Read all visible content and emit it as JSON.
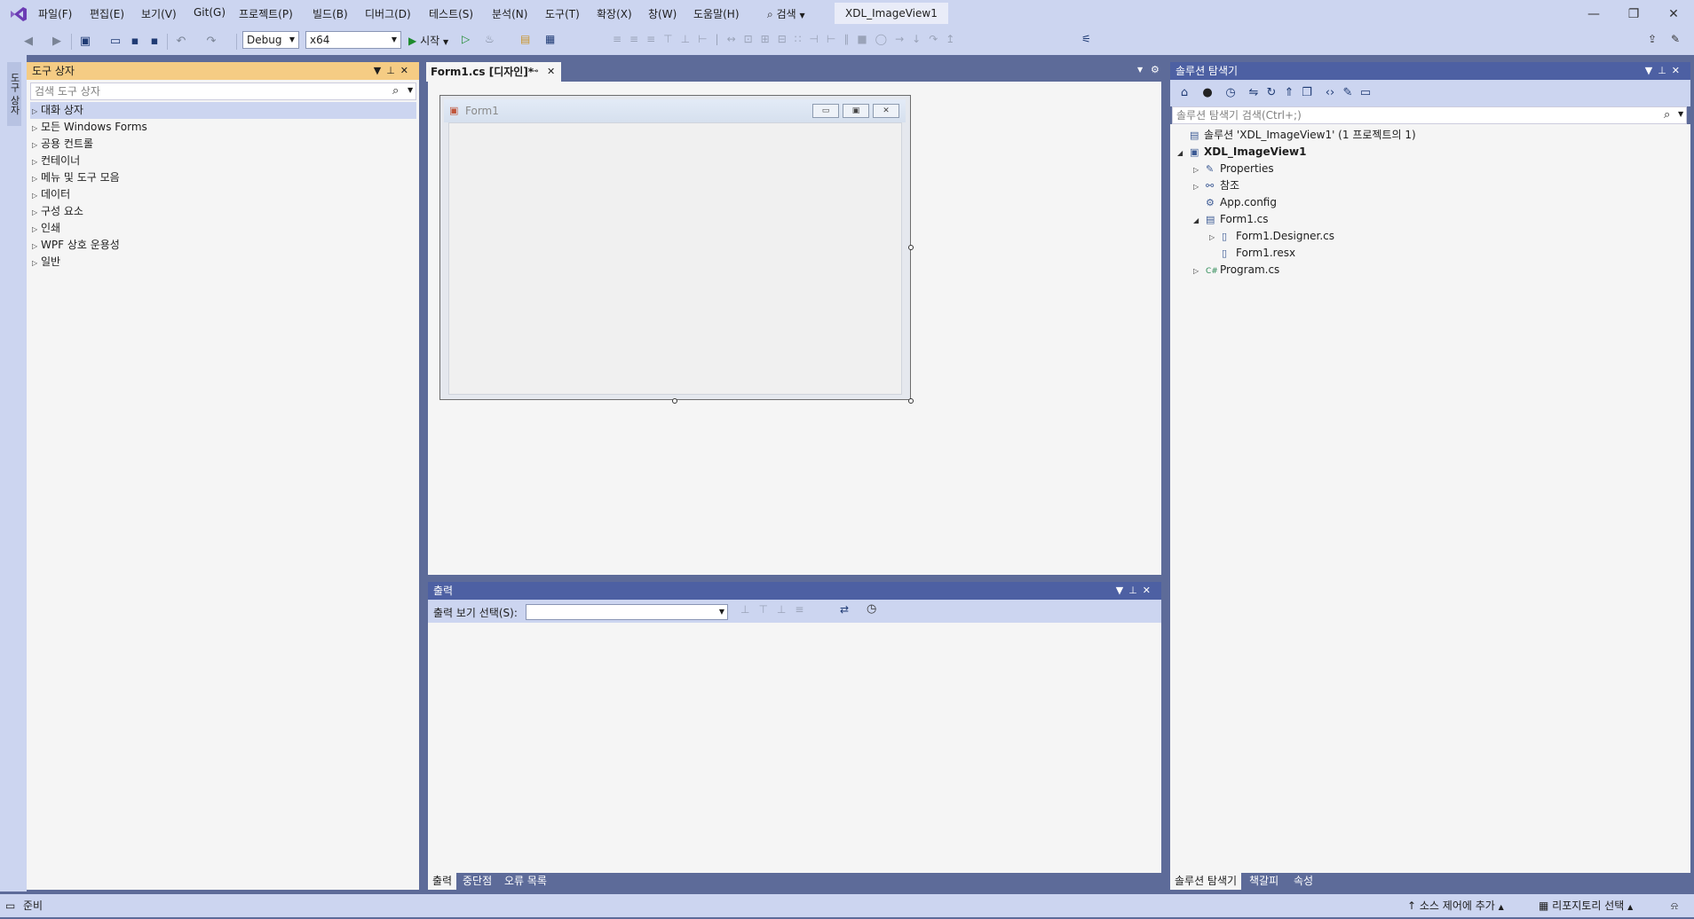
{
  "menu": {
    "items": [
      "파일(F)",
      "편집(E)",
      "보기(V)",
      "Git(G)",
      "프로젝트(P)",
      "빌드(B)",
      "디버그(D)",
      "테스트(S)",
      "분석(N)",
      "도구(T)",
      "확장(X)",
      "창(W)",
      "도움말(H)"
    ],
    "search_label": "검색",
    "solution_title": "XDL_ImageView1"
  },
  "toolbar": {
    "configuration": "Debug",
    "platform": "x64",
    "start_label": "시작"
  },
  "left_strip": {
    "toolbox_tab": "도구 상자"
  },
  "toolbox": {
    "title": "도구 상자",
    "search_placeholder": "검색 도구 상자",
    "categories": [
      "대화 상자",
      "모든 Windows Forms",
      "공용 컨트롤",
      "컨테이너",
      "메뉴 및 도구 모음",
      "데이터",
      "구성 요소",
      "인쇄",
      "WPF 상호 운용성",
      "일반"
    ]
  },
  "designer": {
    "tab_label": "Form1.cs [디자인]*",
    "form_title": "Form1"
  },
  "output": {
    "title": "출력",
    "show_output_label": "출력 보기 선택(S):",
    "tabs": [
      "출력",
      "중단점",
      "오류 목록"
    ]
  },
  "solution_explorer": {
    "title": "솔루션 탐색기",
    "search_placeholder": "솔루션 탐색기 검색(Ctrl+;)",
    "tree": [
      {
        "label": "솔루션 'XDL_ImageView1' (1 프로젝트의 1)",
        "icon": "solution-icon",
        "level": 0,
        "expander": ""
      },
      {
        "label": "XDL_ImageView1",
        "icon": "csharp-project-icon",
        "level": 0,
        "expander": "expanded",
        "bold": true
      },
      {
        "label": "Properties",
        "icon": "wrench-icon",
        "level": 1,
        "expander": "collapsed"
      },
      {
        "label": "참조",
        "icon": "references-icon",
        "level": 1,
        "expander": "collapsed"
      },
      {
        "label": "App.config",
        "icon": "config-file-icon",
        "level": 1,
        "expander": ""
      },
      {
        "label": "Form1.cs",
        "icon": "form-icon",
        "level": 1,
        "expander": "expanded"
      },
      {
        "label": "Form1.Designer.cs",
        "icon": "file-icon",
        "level": 2,
        "expander": "collapsed"
      },
      {
        "label": "Form1.resx",
        "icon": "file-icon",
        "level": 2,
        "expander": ""
      },
      {
        "label": "Program.cs",
        "icon": "csharp-file-icon",
        "level": 1,
        "expander": "collapsed"
      }
    ],
    "tabs": [
      "솔루션 탐색기",
      "책갈피",
      "속성"
    ]
  },
  "statusbar": {
    "ready": "준비",
    "add_source_control": "소스 제어에 추가",
    "select_repository": "리포지토리 선택"
  },
  "colors": {
    "chrome": "#ccd5f0",
    "frame": "#5d6b99",
    "panel_header_active": "#f5cc84",
    "panel_header": "#4d60a3",
    "accent_purple": "#7e57c2"
  }
}
